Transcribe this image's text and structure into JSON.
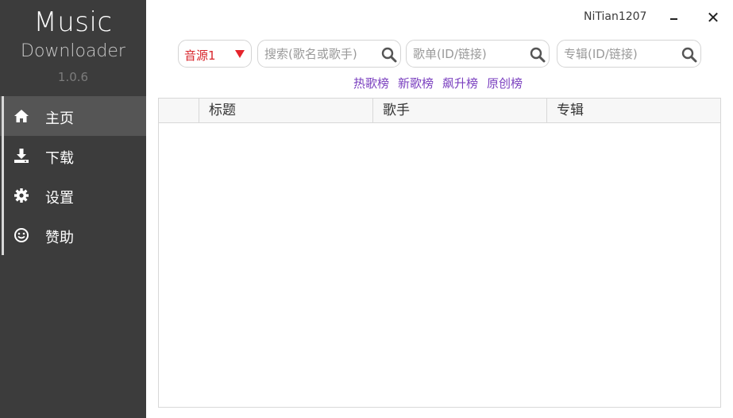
{
  "app": {
    "title": "Music",
    "subtitle": "Downloader",
    "version": "1.0.6"
  },
  "sidebar": {
    "items": [
      {
        "label": "主页",
        "icon": "home-icon",
        "active": true
      },
      {
        "label": "下载",
        "icon": "download-icon",
        "active": false
      },
      {
        "label": "设置",
        "icon": "gear-icon",
        "active": false
      },
      {
        "label": "赞助",
        "icon": "smiley-icon",
        "active": false
      }
    ]
  },
  "header": {
    "username": "NiTian1207",
    "close_glyph": "✕"
  },
  "search": {
    "source": "音源1",
    "song_placeholder": "搜索(歌名或歌手)",
    "playlist_placeholder": "歌单(ID/链接)",
    "album_placeholder": "专辑(ID/链接)"
  },
  "charts": {
    "hot": "热歌榜",
    "new": "新歌榜",
    "rising": "飙升榜",
    "original": "原创榜"
  },
  "table": {
    "columns": [
      "",
      "标题",
      "歌手",
      "专辑"
    ],
    "rows": []
  },
  "colors": {
    "sidebar_bg": "#3c3c3c",
    "active_item_bg": "#555555",
    "source_text": "#d8262c",
    "chart_link": "#7a3fbf"
  }
}
